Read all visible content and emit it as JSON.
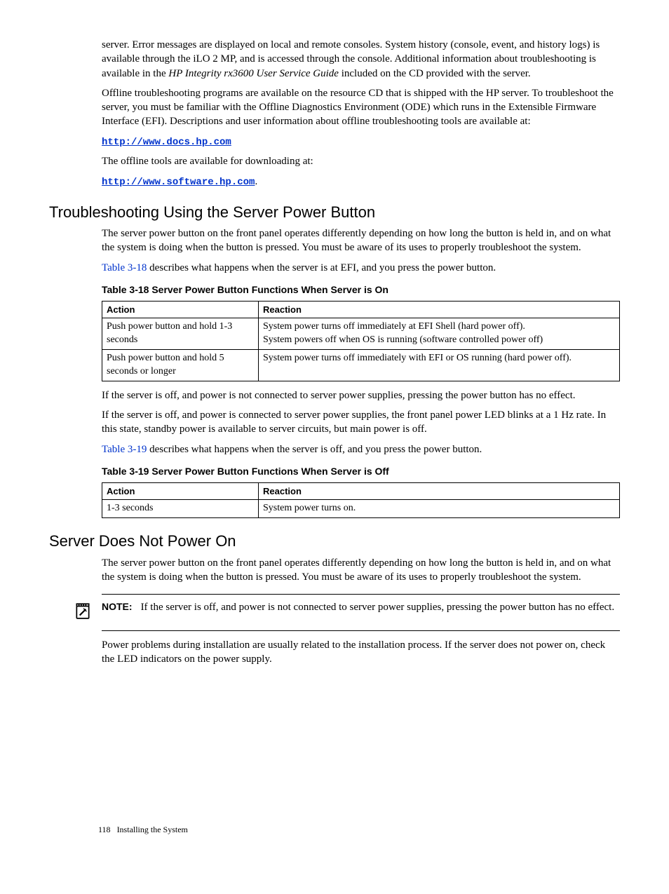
{
  "intro": {
    "p1_a": "server. Error messages are displayed on local and remote consoles. System history (console, event, and history logs) is available through the iLO 2 MP, and is accessed through the console. Additional information about troubleshooting is available in the ",
    "p1_italic": "HP Integrity rx3600 User Service Guide",
    "p1_b": " included on the CD provided with the server.",
    "p2": "Offline troubleshooting programs are available on the resource CD that is shipped with the HP server. To troubleshoot the server, you must be familiar with the Offline Diagnostics Environment (ODE) which runs in the Extensible Firmware Interface (EFI). Descriptions and user information about offline troubleshooting tools are available at:",
    "link1": "http://www.docs.hp.com",
    "p3": "The offline tools are available for downloading at:",
    "link2": "http://www.software.hp.com",
    "link2_suffix": "."
  },
  "section1": {
    "heading": "Troubleshooting Using the Server Power Button",
    "p1": "The server power button on the front panel operates differently depending on how long the button is held in, and on what the system is doing when the button is pressed. You must be aware of its uses to properly troubleshoot the system.",
    "p2_ref": "Table 3-18",
    "p2_rest": " describes what happens when the server is at EFI, and you press the power button.",
    "table1_title": "Table  3-18  Server Power Button Functions When Server is On",
    "table1_headers": {
      "action": "Action",
      "reaction": "Reaction"
    },
    "table1_rows": [
      {
        "action": "Push power button and hold 1-3 seconds",
        "reaction": "System power turns off immediately at EFI Shell (hard power off).\nSystem powers off when OS is running (software controlled power off)"
      },
      {
        "action": "Push power button and hold 5 seconds or longer",
        "reaction": "System power turns off immediately with EFI or OS running (hard power off)."
      }
    ],
    "p3": "If the server is off, and power is not connected to server power supplies, pressing the power button has no effect.",
    "p4": "If the server is off, and power is connected to server power supplies, the front panel power LED blinks at a 1 Hz rate. In this state, standby power is available to server circuits, but main power is off.",
    "p5_ref": "Table 3-19",
    "p5_rest": " describes what happens when the server is off, and you press the power button.",
    "table2_title": "Table  3-19  Server Power Button Functions When Server is Off",
    "table2_headers": {
      "action": "Action",
      "reaction": "Reaction"
    },
    "table2_rows": [
      {
        "action": "1-3 seconds",
        "reaction": "System power turns on."
      }
    ]
  },
  "section2": {
    "heading": "Server Does Not Power On",
    "p1": "The server power button on the front panel operates differently depending on how long the button is held in, and on what the system is doing when the button is pressed. You must be aware of its uses to properly troubleshoot the system.",
    "note_label": "NOTE:",
    "note_text": "If the server is off, and power is not connected to server power supplies, pressing the power button has no effect.",
    "p2": "Power problems during installation are usually related to the installation process. If the server does not power on, check the LED indicators on the power supply."
  },
  "footer": {
    "page": "118",
    "section": "Installing the System"
  }
}
